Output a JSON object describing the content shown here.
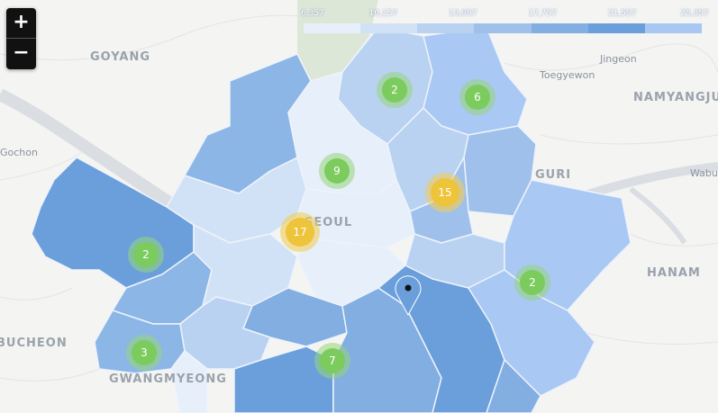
{
  "zoom": {
    "in_label": "+",
    "out_label": "−"
  },
  "legend": {
    "labels": [
      "6,357",
      "10,157",
      "13,957",
      "17,757",
      "21,557",
      "25,357"
    ],
    "colors": [
      "#e6effa",
      "#d2e2f6",
      "#b9d2f1",
      "#9ec0ea",
      "#82aee2",
      "#6b9fdb",
      "#a8c8f3"
    ]
  },
  "places": [
    {
      "id": "goyang",
      "name": "GOYANG",
      "style": "big"
    },
    {
      "id": "gochon",
      "name": "Gochon",
      "style": "small"
    },
    {
      "id": "jingeon",
      "name": "Jingeon",
      "style": "small"
    },
    {
      "id": "toegyewon",
      "name": "Toegyewon",
      "style": "small"
    },
    {
      "id": "namyangju",
      "name": "NAMYANGJU",
      "style": "big"
    },
    {
      "id": "wabu",
      "name": "Wabu",
      "style": "small"
    },
    {
      "id": "guri",
      "name": "GURI",
      "style": "big"
    },
    {
      "id": "seoul",
      "name": "SEOUL",
      "style": "big"
    },
    {
      "id": "hanam",
      "name": "HANAM",
      "style": "big"
    },
    {
      "id": "bucheon",
      "name": "BUCHEON",
      "style": "big"
    },
    {
      "id": "gwangmyeong",
      "name": "GWANGMYEONG",
      "style": "big"
    }
  ],
  "clusters": [
    {
      "id": "c1",
      "count": "2",
      "level": "green"
    },
    {
      "id": "c2",
      "count": "6",
      "level": "green"
    },
    {
      "id": "c3",
      "count": "9",
      "level": "green"
    },
    {
      "id": "c4",
      "count": "15",
      "level": "yellow"
    },
    {
      "id": "c5",
      "count": "17",
      "level": "yellow"
    },
    {
      "id": "c6",
      "count": "2",
      "level": "green"
    },
    {
      "id": "c7",
      "count": "2",
      "level": "green"
    },
    {
      "id": "c8",
      "count": "3",
      "level": "green"
    },
    {
      "id": "c9",
      "count": "7",
      "level": "green"
    }
  ],
  "cluster_colors": {
    "green": {
      "halo": "rgba(150,214,120,0.55)",
      "core": "#7ccb5d"
    },
    "yellow": {
      "halo": "rgba(240,205,90,0.6)",
      "core": "#eec43a"
    }
  },
  "marker": {
    "icon": "map-pin-icon"
  }
}
